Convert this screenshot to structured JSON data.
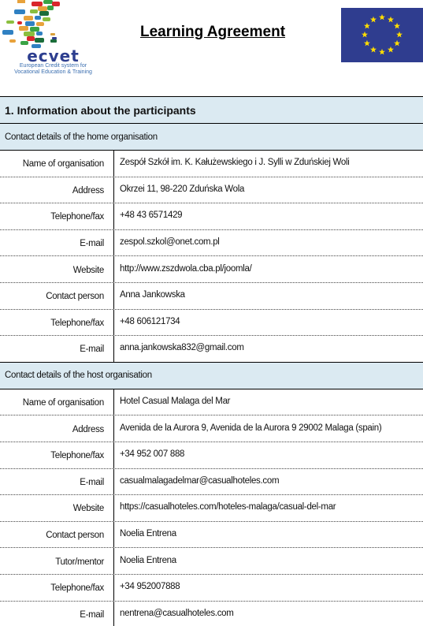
{
  "header": {
    "title": "Learning Agreement",
    "logo": {
      "name": "ecvet",
      "subtitle_line1": "European Credit system for",
      "subtitle_line2": "Vocational Education & Training"
    },
    "flag": "eu-flag"
  },
  "section": {
    "number_title": "1.   Information about the participants"
  },
  "home": {
    "heading": "Contact details of the home organisation",
    "rows": [
      {
        "label": "Name of organisation",
        "value": "Zespół Szkół im. K. Kałużewskiego i J. Sylli  w Zduńskiej Woli"
      },
      {
        "label": "Address",
        "value": "Okrzei 11, 98-220 Zduńska Wola"
      },
      {
        "label": "Telephone/fax",
        "value": "+48 43 6571429"
      },
      {
        "label": "E-mail",
        "value": "zespol.szkol@onet.com.pl"
      },
      {
        "label": "Website",
        "value": "http://www.zszdwola.cba.pl/joomla/"
      },
      {
        "label": "Contact person",
        "value": "Anna Jankowska"
      },
      {
        "label": "Telephone/fax",
        "value": "+48 606121734"
      },
      {
        "label": "E-mail",
        "value": "anna.jankowska832@gmail.com"
      }
    ]
  },
  "host": {
    "heading": "Contact details of the host organisation",
    "rows": [
      {
        "label": "Name of organisation",
        "value": "Hotel Casual Malaga del Mar"
      },
      {
        "label": "Address",
        "value": "Avenida de la Aurora 9, Avenida de la  Aurora 9 29002 Malaga (spain)"
      },
      {
        "label": "Telephone/fax",
        "value": "+34 952 007 888"
      },
      {
        "label": "E-mail",
        "value": "casualmalagadelmar@casualhoteles.com"
      },
      {
        "label": "Website",
        "value": "https://casualhoteles.com/hoteles-malaga/casual-del-mar"
      },
      {
        "label": "Contact person",
        "value": "Noelia  Entrena"
      },
      {
        "label": "Tutor/mentor",
        "value": "Noelia Entrena"
      },
      {
        "label": "Telephone/fax",
        "value": "+34 952007888"
      },
      {
        "label": "E-mail",
        "value": "nentrena@casualhoteles.com"
      }
    ]
  },
  "colors": {
    "header_fill": "#dbeaf2",
    "flag_blue": "#2f3d8f",
    "flag_star": "#ffdd00",
    "ecvet_blue": "#2d3e8f"
  }
}
